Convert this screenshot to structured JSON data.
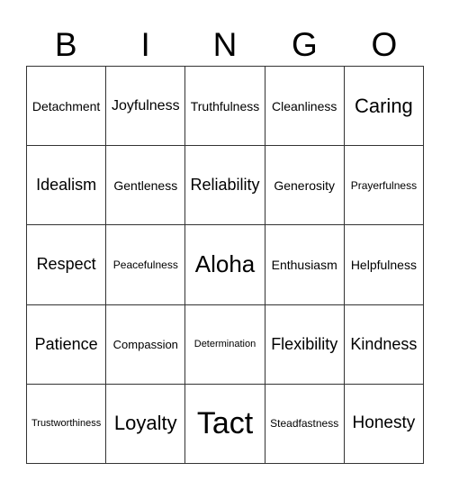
{
  "header": [
    "B",
    "I",
    "N",
    "G",
    "O"
  ],
  "cells": [
    "Detachment",
    "Joyfulness",
    "Truthfulness",
    "Cleanliness",
    "Caring",
    "Idealism",
    "Gentleness",
    "Reliability",
    "Generosity",
    "Prayerfulness",
    "Respect",
    "Peacefulness",
    "Aloha",
    "Enthusiasm",
    "Helpfulness",
    "Patience",
    "Compassion",
    "Determination",
    "Flexibility",
    "Kindness",
    "Trustworthiness",
    "Loyalty",
    "Tact",
    "Steadfastness",
    "Honesty"
  ]
}
